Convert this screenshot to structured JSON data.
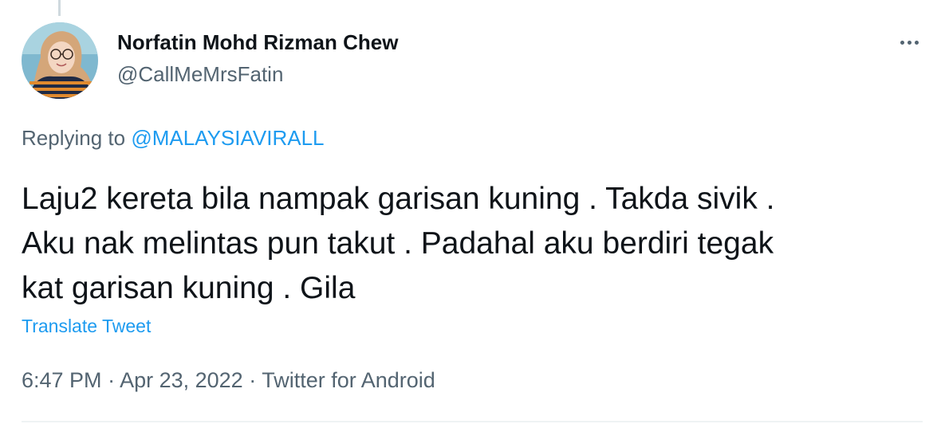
{
  "author": {
    "name": "Norfatin Mohd Rizman Chew",
    "handle": "@CallMeMrsFatin"
  },
  "reply": {
    "prefix": "Replying to ",
    "mention": "@MALAYSIAVIRALL"
  },
  "tweet": {
    "lines": [
      "Laju2 kereta bila nampak garisan kuning . Takda sivik .",
      "Aku nak melintas pun takut . Padahal aku berdiri tegak",
      "kat garisan kuning . Gila"
    ],
    "translate_label": "Translate Tweet"
  },
  "meta": {
    "time": "6:47 PM",
    "separator": " · ",
    "date": "Apr 23, 2022",
    "source": "Twitter for Android"
  },
  "icons": {
    "more": "more-horizontal-icon"
  },
  "colors": {
    "link": "#1d9bf0",
    "secondary_text": "#536471",
    "primary_text": "#0f1419"
  }
}
